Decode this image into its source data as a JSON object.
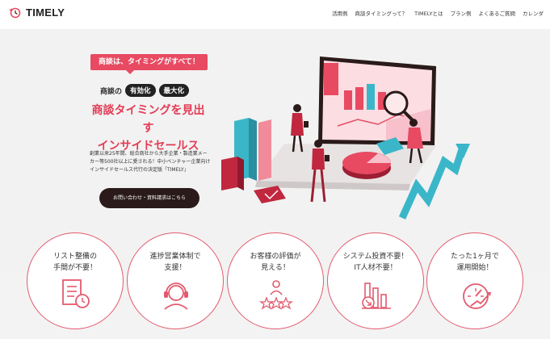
{
  "header": {
    "logo_text": "TIMELY",
    "nav": [
      "活用例",
      "商談タイミングって？",
      "TIMELYとは",
      "プラン例",
      "よくあるご質問",
      "カレンダ"
    ]
  },
  "hero": {
    "tagline": "商談は、タイミングがすべて！",
    "subline_prefix": "商談の",
    "pill_1": "有効化",
    "pill_2": "最大化",
    "headline_1": "商談タイミングを見出す",
    "headline_2": "インサイドセールス",
    "body_text": "創業以来25年間、総合商社から大手企業・製造業メーカー等500社以上に愛される！中小ベンチャー企業向けインサイドセールス代行の決定版「TIMELY」",
    "cta_label": "お問い合わせ・資料請求はこちら"
  },
  "features": [
    {
      "line1": "リスト整備の",
      "line2": "手間が不要！",
      "icon": "checklist-clock-icon"
    },
    {
      "line1": "進捗営業体制で",
      "line2": "支援！",
      "icon": "headset-operator-icon"
    },
    {
      "line1": "お客様の評価が",
      "line2": "見える！",
      "icon": "rating-stars-icon"
    },
    {
      "line1": "システム投資不要！",
      "line2": "IT人材不要！",
      "icon": "bar-chart-down-icon"
    },
    {
      "line1": "たった1ヶ月で",
      "line2": "運用開始！",
      "icon": "speedometer-icon"
    }
  ],
  "colors": {
    "accent": "#e84a62",
    "dark": "#2a1a1a",
    "teal": "#3bb6c9",
    "background": "#f2f2f2"
  }
}
